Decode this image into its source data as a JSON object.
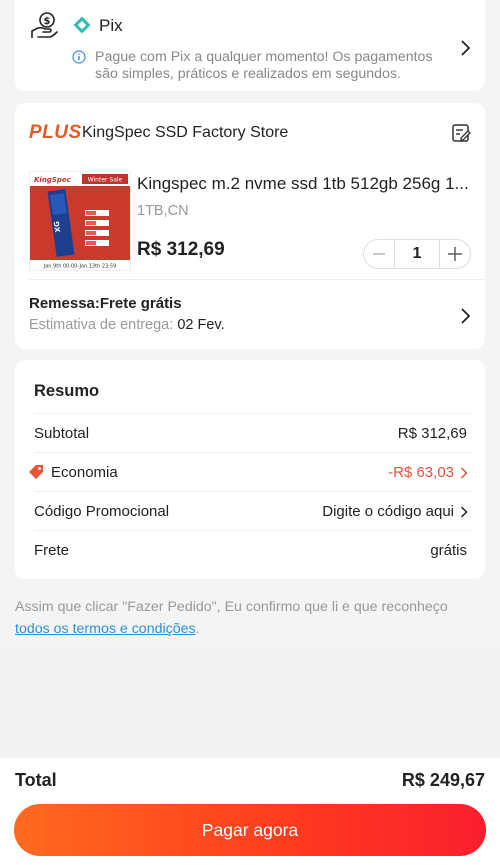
{
  "payment": {
    "method": "Pix",
    "description": "Pague com Pix a qualquer momento! Os pagamentos são simples, práticos e realizados em segundos."
  },
  "store": {
    "badge": "PLUS",
    "name": "KingSpec SSD Factory Store",
    "product": {
      "image_brand": "KingSpec",
      "image_banner": "Winter Sale",
      "image_dates": "Jan.9th 00:00-Jan.13th 23:59",
      "title": "Kingspec m.2 nvme ssd 1tb 512gb 256g 1...",
      "variant": "1TB,CN",
      "price": "R$ 312,69",
      "quantity": "1"
    },
    "shipping": {
      "title": "Remessa:Frete grátis",
      "estimate_label": "Estimativa de entrega: ",
      "estimate_date": "02 Fev."
    }
  },
  "summary": {
    "title": "Resumo",
    "rows": [
      {
        "label": "Subtotal",
        "value": "R$ 312,69"
      },
      {
        "label": "Economia",
        "value": "-R$ 63,03"
      },
      {
        "label": "Código Promocional",
        "value": "Digite o código aqui"
      },
      {
        "label": "Frete",
        "value": "grátis"
      }
    ]
  },
  "terms": {
    "text": "Assim que clicar \"Fazer Pedido\", Eu confirmo que li e que reconheço ",
    "link": "todos os termos e condições",
    "suffix": "."
  },
  "footer": {
    "total_label": "Total",
    "total_value": "R$ 249,67",
    "pay_button": "Pagar agora"
  },
  "colors": {
    "accent": "#ff3a1f",
    "saving": "#e8533a",
    "link": "#2c8fd6",
    "pix": "#32bcad"
  }
}
